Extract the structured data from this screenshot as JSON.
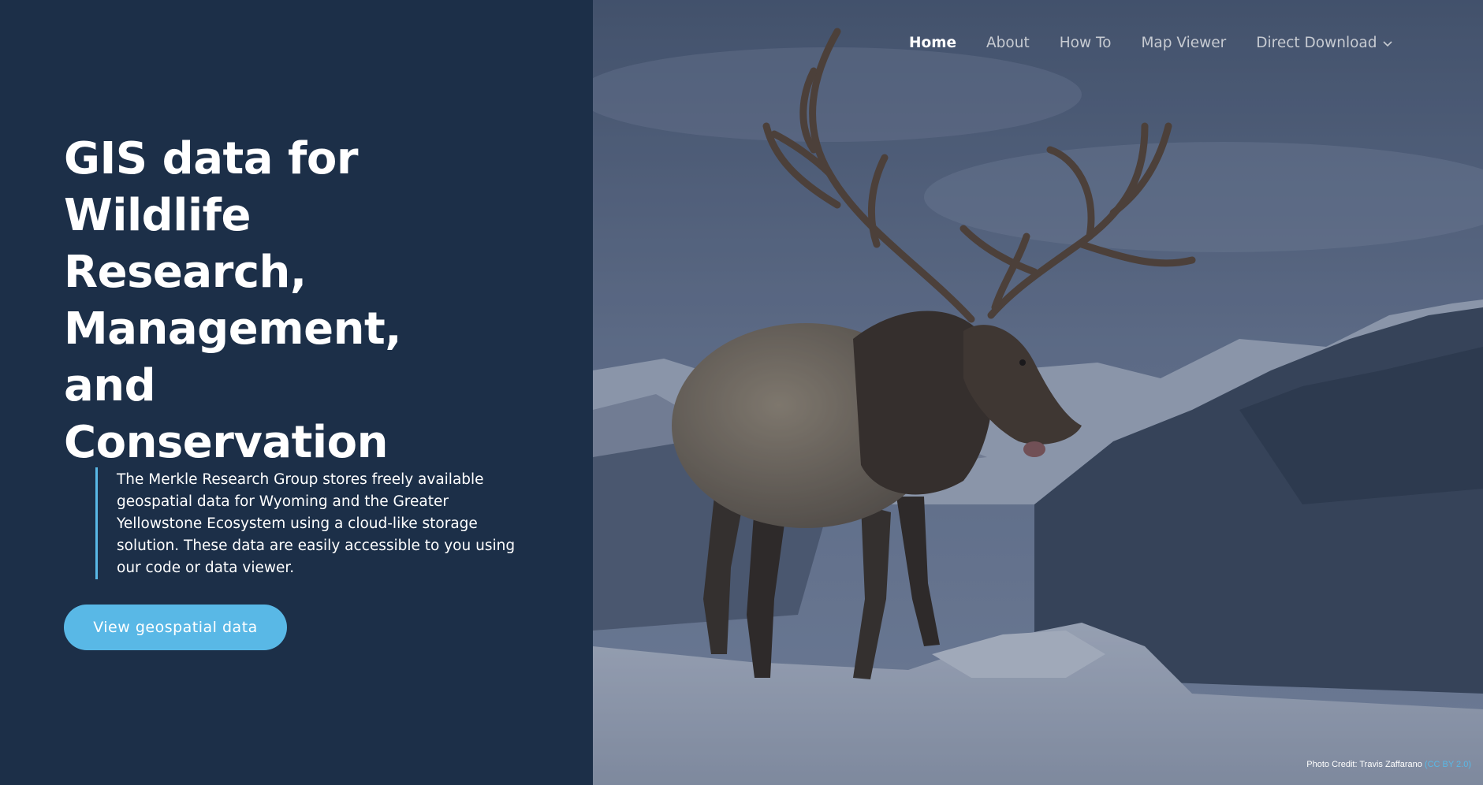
{
  "nav": {
    "items": [
      {
        "label": "Home",
        "active": true
      },
      {
        "label": "About"
      },
      {
        "label": "How To"
      },
      {
        "label": "Map Viewer"
      },
      {
        "label": "Direct Download",
        "icon": "chevron-down-icon"
      }
    ]
  },
  "hero": {
    "title_lines": [
      "GIS data for",
      "Wildlife",
      "Research,",
      "Management, and",
      "Conservation"
    ],
    "description": "The Merkle Research Group stores freely available geospatial data for Wyoming and the Greater Yellowstone Ecosystem using a cloud-like storage solution. These data are easily accessible to you using our code or data viewer.",
    "cta_label": "View geospatial data"
  },
  "photo": {
    "credit_text": "Photo Credit: Travis Zaffarano",
    "license_label": "(CC BY 2.0)"
  },
  "colors": {
    "panel_bg": "#1c2f48",
    "accent": "#59b8e6",
    "text": "#ffffff",
    "nav_inactive": "#c7cbd2"
  }
}
